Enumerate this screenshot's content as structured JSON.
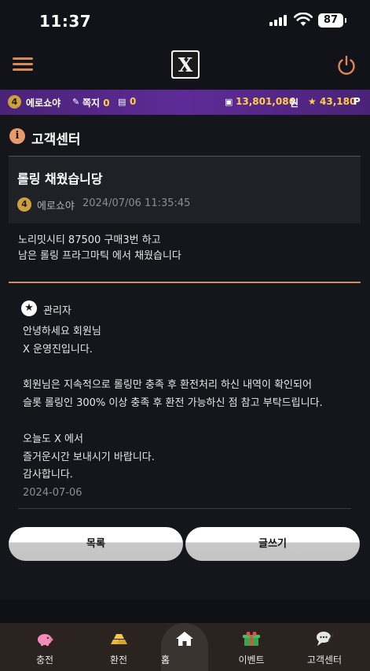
{
  "status_bar": {
    "time": "11:37",
    "battery": "87"
  },
  "header": {
    "logo_text": "X"
  },
  "info_bar": {
    "level": "4",
    "username": "에로쇼야",
    "memo_label": "쪽지",
    "memo_count": "0",
    "message_count": "0",
    "money": "13,801,086",
    "money_unit": "원",
    "point": "43,180",
    "point_unit": "P"
  },
  "page": {
    "title_icon": "i",
    "title": "고객센터"
  },
  "post": {
    "title": "롤링 채웠습니당",
    "level": "4",
    "author": "에로쇼야",
    "datetime": "2024/07/06 11:35:45",
    "body_line1": "노리밋시티 87500 구매3번 하고",
    "body_line2": "남은 롤링 프라그마틱 에서 채웠습니다"
  },
  "reply": {
    "author": "관리자",
    "body": "안녕하세요 회원님\nX 운영진입니다.\n\n회원님은 지속적으로 롤링만 충족 후 환전처리 하신 내역이 확인되어\n슬롯 롤링인 300% 이상 충족 후 환전 가능하신 점 참고 부탁드립니다.\n\n오늘도 X 에서\n즐거운시간 보내시기 바랍니다.\n감사합니다.",
    "date": "2024-07-06"
  },
  "buttons": {
    "list": "목록",
    "write": "글쓰기"
  },
  "bottom_nav": {
    "items": [
      {
        "label": "충전",
        "icon": "piggy-bank-icon"
      },
      {
        "label": "환전",
        "icon": "gold-bars-icon"
      },
      {
        "label": "홈",
        "icon": "home-icon"
      },
      {
        "label": "이벤트",
        "icon": "gift-icon"
      },
      {
        "label": "고객센터",
        "icon": "support-chat-icon"
      }
    ]
  },
  "colors": {
    "accent": "#d9885a",
    "info_bar": "#5e2b96",
    "highlight": "#ffcf4a",
    "background": "#14161b"
  }
}
